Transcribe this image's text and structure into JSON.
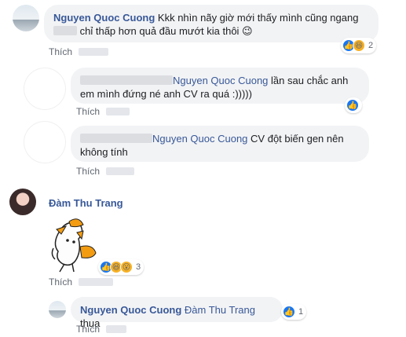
{
  "comments": [
    {
      "author": "Nguyen Quoc Cuong",
      "line1": "Kkk nhìn nãy giờ mới thấy mình cũng ngang",
      "line2": "chỉ thấp hơn quả đầu mướt kia thôi 😉",
      "like_label": "Thích",
      "reaction_count": "2"
    },
    {
      "tag_name": "Nguyen Quoc Cuong",
      "line1_tail": "lần sau chắc anh",
      "line2": "em mình đứng né anh CV ra quá :)))))",
      "like_label": "Thích"
    },
    {
      "tag_name": "Nguyen Quoc Cuong",
      "line1_tail": "CV đột biến gen nên",
      "line2": "không tính",
      "like_label": "Thích"
    },
    {
      "author": "Đàm Thu Trang",
      "like_label": "Thích",
      "reaction_count": "3"
    },
    {
      "author": "Nguyen Quoc Cuong",
      "tag_name": "Đàm Thu Trang",
      "text_tail": "thua",
      "like_label": "Thích",
      "reaction_count": "1"
    }
  ],
  "colors": {
    "link_blue": "#385898",
    "bubble_bg": "#f2f3f5",
    "like_blue": "#1877f2",
    "emoji_yellow": "#f7b125",
    "sticker_orange": "#f39c12"
  },
  "icons": [
    "like-icon",
    "haha-icon",
    "wow-icon"
  ]
}
